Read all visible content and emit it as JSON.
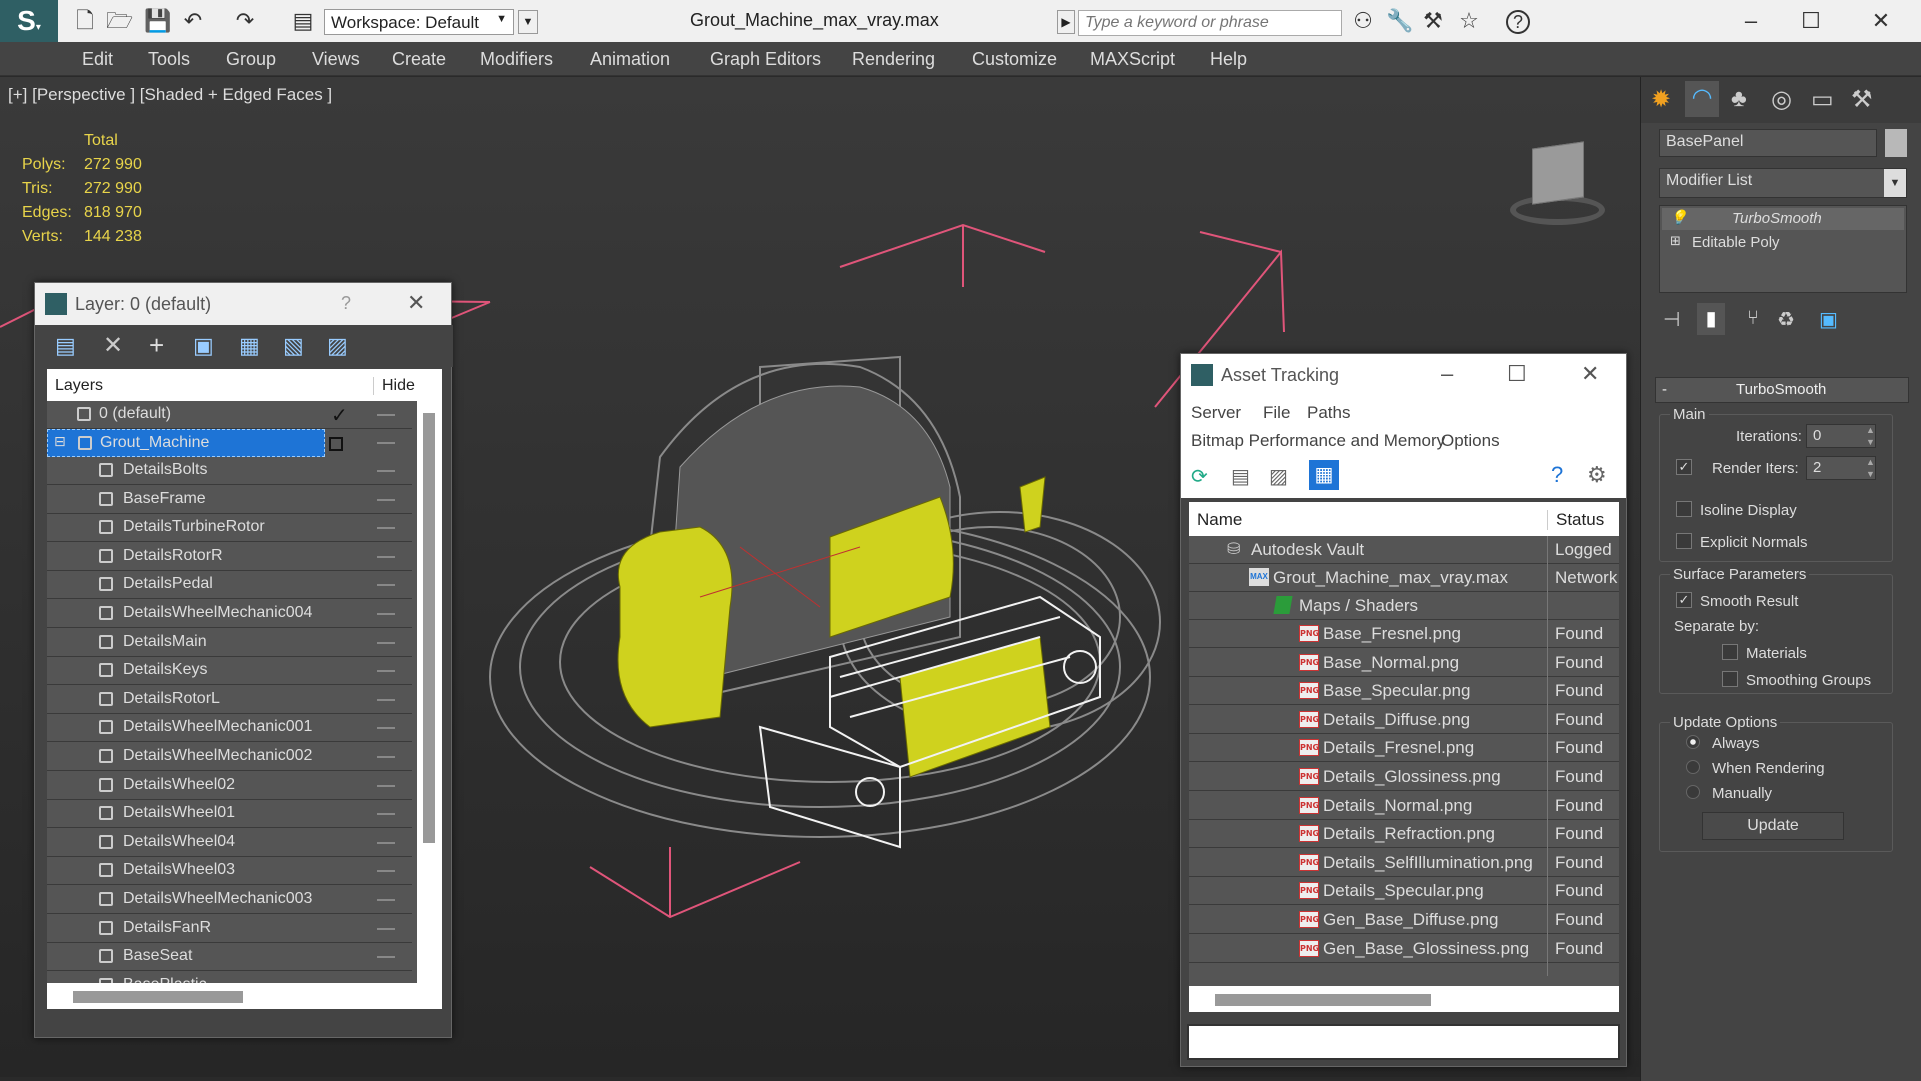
{
  "title_bar": {
    "workspace_label": "Workspace: Default",
    "file_title": "Grout_Machine_max_vray.max",
    "search_placeholder": "Type a keyword or phrase"
  },
  "menu": [
    "Edit",
    "Tools",
    "Group",
    "Views",
    "Create",
    "Modifiers",
    "Animation",
    "Graph Editors",
    "Rendering",
    "Customize",
    "MAXScript",
    "Help"
  ],
  "viewport": {
    "label": "[+] [Perspective ] [Shaded + Edged Faces ]",
    "stats": {
      "header": "Total",
      "rows": [
        {
          "k": "Polys:",
          "v": "272 990"
        },
        {
          "k": "Tris:",
          "v": "272 990"
        },
        {
          "k": "Edges:",
          "v": "818 970"
        },
        {
          "k": "Verts:",
          "v": "144 238"
        }
      ]
    }
  },
  "layer_window": {
    "title": "Layer: 0 (default)",
    "help": "?",
    "col_layers": "Layers",
    "col_hide": "Hide",
    "default_layer": "0 (default)",
    "group_layer": "Grout_Machine",
    "items": [
      "DetailsBolts",
      "BaseFrame",
      "DetailsTurbineRotor",
      "DetailsRotorR",
      "DetailsPedal",
      "DetailsWheelMechanic004",
      "DetailsMain",
      "DetailsKeys",
      "DetailsRotorL",
      "DetailsWheelMechanic001",
      "DetailsWheelMechanic002",
      "DetailsWheel02",
      "DetailsWheel01",
      "DetailsWheel04",
      "DetailsWheel03",
      "DetailsWheelMechanic003",
      "DetailsFanR",
      "BaseSeat",
      "BasePlastic"
    ]
  },
  "asset_window": {
    "title": "Asset Tracking",
    "menu1": [
      "Server",
      "File",
      "Paths"
    ],
    "menu2": [
      "Bitmap Performance and Memory",
      "Options"
    ],
    "col_name": "Name",
    "col_status": "Status",
    "vault": {
      "name": "Autodesk Vault",
      "status": "Logged"
    },
    "maxfile": {
      "name": "Grout_Machine_max_vray.max",
      "status": "Network"
    },
    "maps": "Maps / Shaders",
    "files": [
      {
        "name": "Base_Fresnel.png",
        "status": "Found"
      },
      {
        "name": "Base_Normal.png",
        "status": "Found"
      },
      {
        "name": "Base_Specular.png",
        "status": "Found"
      },
      {
        "name": "Details_Diffuse.png",
        "status": "Found"
      },
      {
        "name": "Details_Fresnel.png",
        "status": "Found"
      },
      {
        "name": "Details_Glossiness.png",
        "status": "Found"
      },
      {
        "name": "Details_Normal.png",
        "status": "Found"
      },
      {
        "name": "Details_Refraction.png",
        "status": "Found"
      },
      {
        "name": "Details_SelfIllumination.png",
        "status": "Found"
      },
      {
        "name": "Details_Specular.png",
        "status": "Found"
      },
      {
        "name": "Gen_Base_Diffuse.png",
        "status": "Found"
      },
      {
        "name": "Gen_Base_Glossiness.png",
        "status": "Found"
      }
    ]
  },
  "right_panel": {
    "object_name": "BasePanel",
    "modifier_list": "Modifier List",
    "stack": [
      "TurboSmooth",
      "Editable Poly"
    ],
    "rollout_title": "TurboSmooth",
    "main_label": "Main",
    "iterations_label": "Iterations:",
    "iterations_value": "0",
    "render_iters_label": "Render Iters:",
    "render_iters_value": "2",
    "isoline": "Isoline Display",
    "explicit": "Explicit Normals",
    "surface_label": "Surface Parameters",
    "smooth_result": "Smooth Result",
    "separate_by": "Separate by:",
    "materials": "Materials",
    "smoothing_groups": "Smoothing Groups",
    "update_label": "Update Options",
    "always": "Always",
    "when_rendering": "When Rendering",
    "manually": "Manually",
    "update_button": "Update",
    "collapse_sign": "-"
  },
  "colors": {
    "accent": "#1e74d6",
    "stats": "#e8d44a",
    "highlight_yellow": "#d6d61e"
  }
}
